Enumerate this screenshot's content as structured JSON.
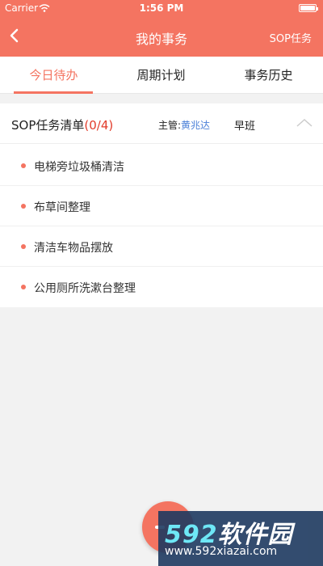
{
  "status_bar": {
    "carrier": "Carrier",
    "time": "1:56 PM"
  },
  "nav": {
    "title": "我的事务",
    "right_action": "SOP任务"
  },
  "tabs": [
    {
      "label": "今日待办",
      "active": true
    },
    {
      "label": "周期计划",
      "active": false
    },
    {
      "label": "事务历史",
      "active": false
    }
  ],
  "card": {
    "title": "SOP任务清单",
    "count": "(0/4)",
    "supervisor_label": "主管:",
    "supervisor_name": "黄兆达",
    "shift": "早班",
    "tasks": [
      {
        "label": "电梯旁垃圾桶清洁"
      },
      {
        "label": "布草间整理"
      },
      {
        "label": "清洁车物品摆放"
      },
      {
        "label": "公用厕所洗漱台整理"
      }
    ]
  },
  "watermark": {
    "brand_num": "592",
    "brand_text": "软件园",
    "url": "www.592xiazai.com"
  },
  "colors": {
    "accent": "#f47461",
    "count_red": "#e23b2a",
    "supervisor_blue": "#4a7fd8"
  }
}
